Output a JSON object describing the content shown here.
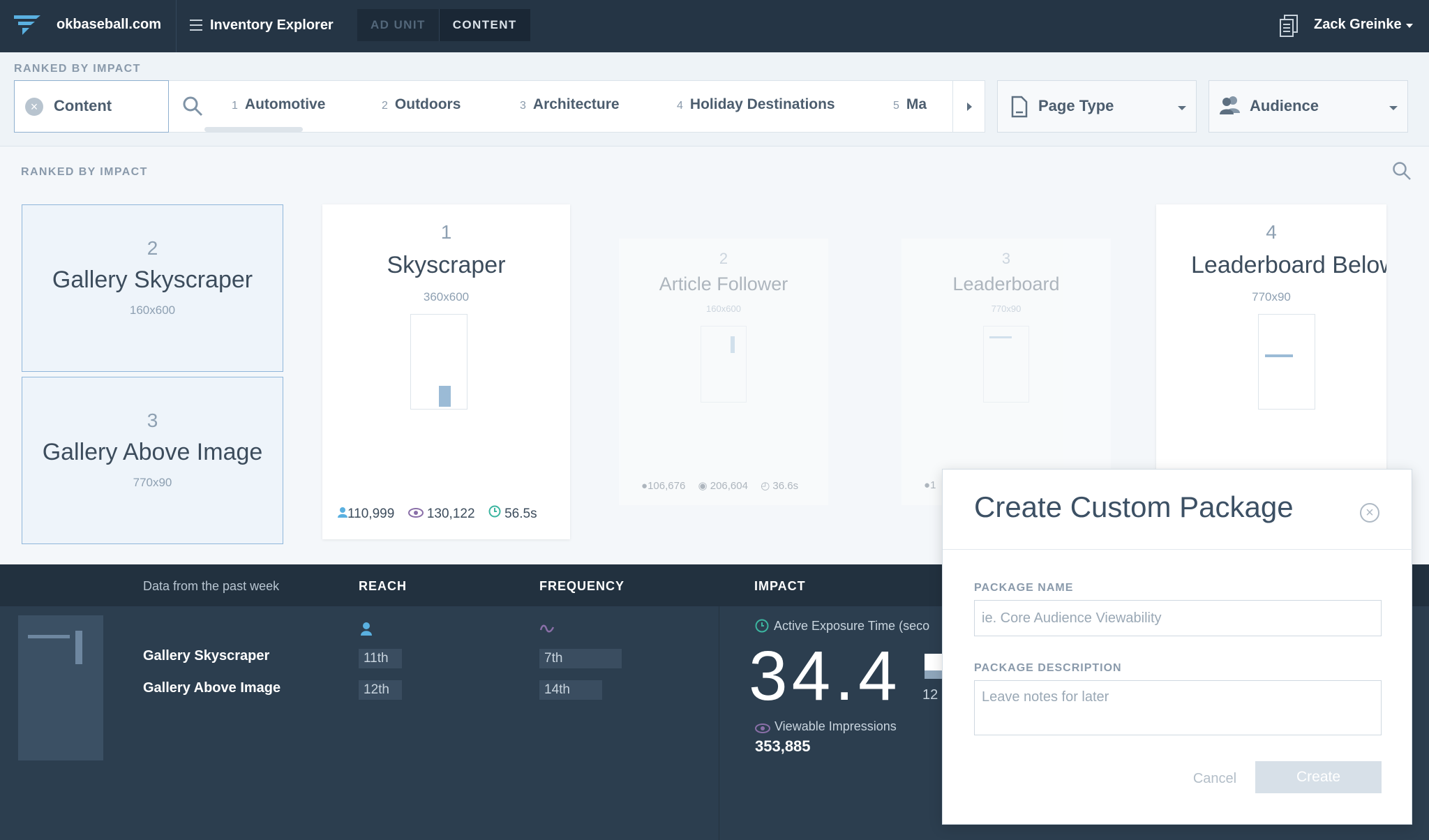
{
  "nav": {
    "site": "okbaseball.com",
    "section": "Inventory Explorer",
    "toggle_ad_unit": "AD UNIT",
    "toggle_content": "CONTENT",
    "user": "Zack Greinke"
  },
  "filters": {
    "heading": "RANKED BY IMPACT",
    "chip_label": "Content",
    "tabs": [
      {
        "num": "1",
        "label": "Automotive"
      },
      {
        "num": "2",
        "label": "Outdoors"
      },
      {
        "num": "3",
        "label": "Architecture"
      },
      {
        "num": "4",
        "label": "Holiday Destinations"
      },
      {
        "num": "5",
        "label": "Ma"
      }
    ],
    "page_type": "Page Type",
    "audience": "Audience"
  },
  "ranked": {
    "heading": "RANKED BY IMPACT",
    "selected": [
      {
        "rank": "2",
        "name": "Gallery Skyscraper",
        "size": "160x600"
      },
      {
        "rank": "3",
        "name": "Gallery Above Image",
        "size": "770x90"
      }
    ],
    "cards": [
      {
        "rank": "1",
        "name": "Skyscraper",
        "size": "360x600",
        "reach": "110,999",
        "views": "130,122",
        "time": "56.5s"
      },
      {
        "rank": "2",
        "name": "Article Follower",
        "size": "160x600",
        "reach": "106,676",
        "views": "206,604",
        "time": "36.6s"
      },
      {
        "rank": "3",
        "name": "Leaderboard",
        "size": "770x90",
        "reach": "1"
      },
      {
        "rank": "4",
        "name": "Leaderboard Below",
        "size": "770x90"
      }
    ]
  },
  "summary": {
    "note": "Data from the past week",
    "reach_header": "REACH",
    "frequency_header": "FREQUENCY",
    "impact_header": "IMPACT",
    "rows": [
      {
        "name": "Gallery Skyscraper",
        "reach": "11th",
        "frequency": "7th"
      },
      {
        "name": "Gallery Above Image",
        "reach": "12th",
        "frequency": "14th"
      }
    ],
    "exposure_label": "Active Exposure Time (seco",
    "exposure_value": "34.4",
    "exposure_sub": "12",
    "viewable_label": "Viewable Impressions",
    "viewable_value": "353,885"
  },
  "modal": {
    "title": "Create Custom Package",
    "name_label": "PACKAGE NAME",
    "name_placeholder": "ie. Core Audience Viewability",
    "desc_label": "PACKAGE DESCRIPTION",
    "desc_placeholder": "Leave notes for later",
    "cancel": "Cancel",
    "create": "Create"
  },
  "colors": {
    "nav_bg": "#253545",
    "accent": "#5ab0e0",
    "selected_border": "#8fb6da",
    "panel_bg": "#2c3e4f"
  }
}
